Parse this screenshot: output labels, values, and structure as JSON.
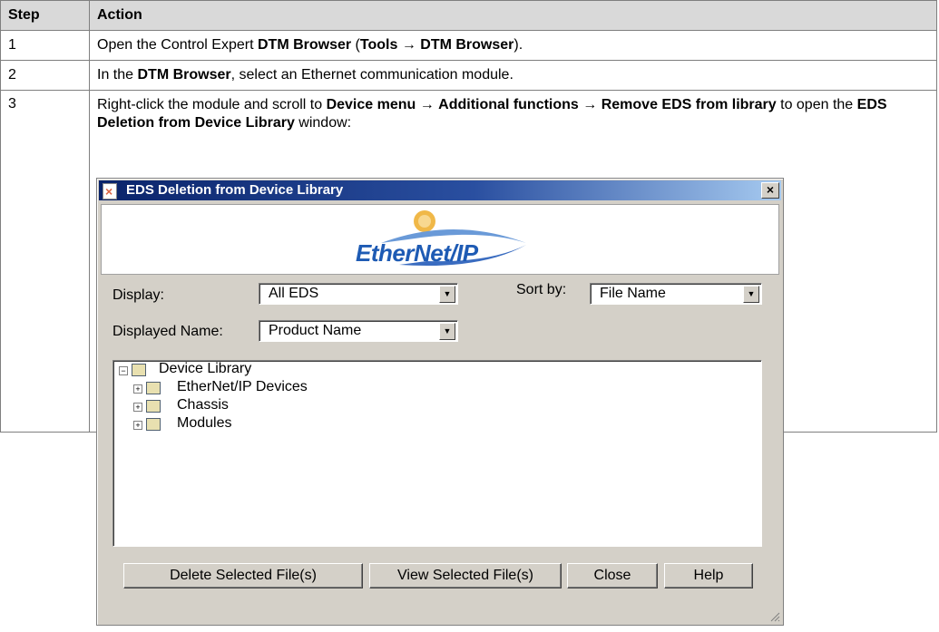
{
  "table": {
    "headers": {
      "step": "Step",
      "action": "Action"
    },
    "rows": [
      {
        "step": "1"
      },
      {
        "step": "2"
      },
      {
        "step": "3"
      }
    ]
  },
  "row1": {
    "t1": "Open the Control Expert ",
    "b1": "DTM Browser",
    "t2": " (",
    "b2": "Tools",
    "t3": " → ",
    "b3": "DTM Browser",
    "t4": ")."
  },
  "row2": {
    "t1": "In the ",
    "b1": "DTM Browser",
    "t2": ", select an Ethernet communication module."
  },
  "row3": {
    "t1": "Right-click the module and scroll to ",
    "b1": "Device menu",
    "t2": " → ",
    "b2": "Additional functions",
    "t3": " → ",
    "b3": "Remove EDS from library",
    "t4": " to open the ",
    "b4": "EDS Deletion from Device Library",
    "t5": " window:"
  },
  "dialog": {
    "title": "EDS Deletion from Device Library",
    "close_glyph": "×",
    "logo_text": "EtherNet/IP",
    "display_label": "Display:",
    "display_value": "All EDS",
    "sort_label": "Sort by:",
    "sort_value": "File Name",
    "displayed_name_label": "Displayed Name:",
    "displayed_name_value": "Product Name",
    "tree": {
      "root": "Device Library",
      "children": [
        "EtherNet/IP Devices",
        "Chassis",
        "Modules"
      ]
    },
    "buttons": {
      "delete": "Delete Selected File(s)",
      "view": "View Selected File(s)",
      "close": "Close",
      "help": "Help"
    }
  },
  "colors": {
    "header_bg": "#d9d9d9",
    "dialog_bg": "#d4d0c8",
    "title_start": "#0a246a",
    "title_end": "#a6caf0",
    "logo_blue": "#1e5bb4"
  }
}
